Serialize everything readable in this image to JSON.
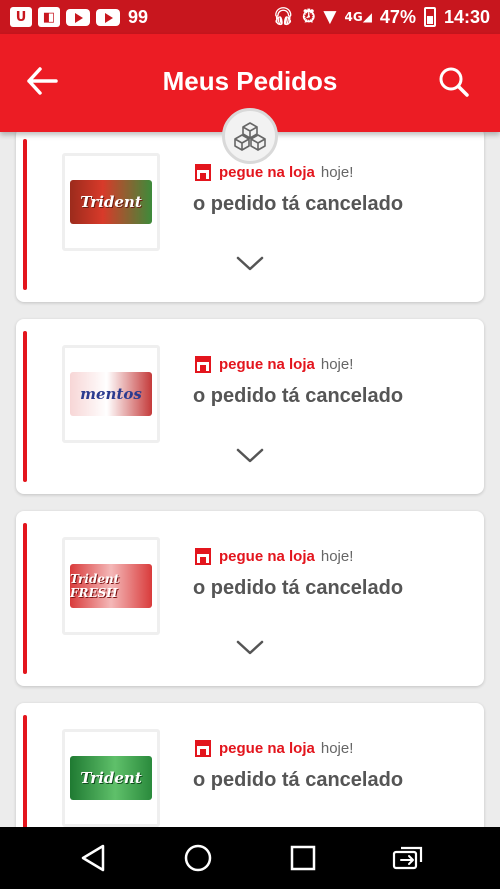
{
  "status_bar": {
    "notification_count": "99",
    "network": "4G",
    "battery": "47%",
    "time": "14:30"
  },
  "app_bar": {
    "title": "Meus Pedidos"
  },
  "orders": [
    {
      "product_name": "Trident",
      "pickup_label": "pegue na loja",
      "pickup_when": "hoje!",
      "status": "o pedido tá cancelado"
    },
    {
      "product_name": "mentos",
      "pickup_label": "pegue na loja",
      "pickup_when": "hoje!",
      "status": "o pedido tá cancelado"
    },
    {
      "product_name": "Trident FRESH",
      "pickup_label": "pegue na loja",
      "pickup_when": "hoje!",
      "status": "o pedido tá cancelado"
    },
    {
      "product_name": "Trident",
      "pickup_label": "pegue na loja",
      "pickup_when": "hoje!",
      "status": "o pedido tá cancelado"
    }
  ],
  "colors": {
    "brand_red": "#ec1c24",
    "status_bar_red": "#c8161e",
    "accent": "#e3151d",
    "background": "#ececec"
  },
  "icons": {
    "back": "arrow-left-icon",
    "search": "search-icon",
    "boxes": "boxes-icon",
    "store": "store-icon",
    "expand": "chevron-down-icon"
  }
}
